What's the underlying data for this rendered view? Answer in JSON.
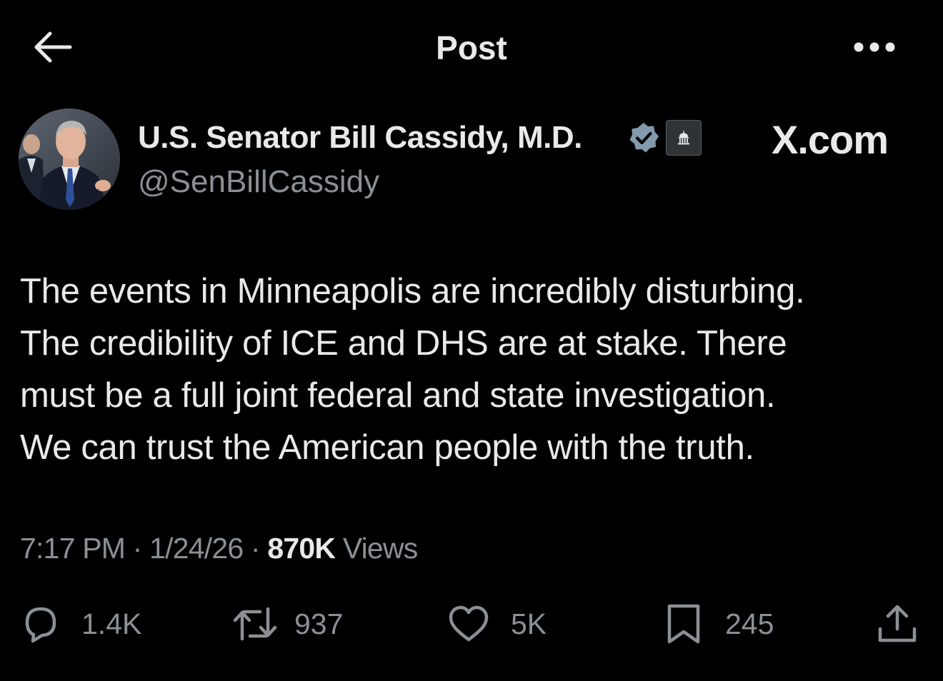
{
  "header": {
    "title": "Post",
    "back_icon": "arrow-left-icon",
    "more_icon": "more-horizontal-icon"
  },
  "author": {
    "display_name": "U.S. Senator Bill Cassidy, M.D.",
    "handle": "@SenBillCassidy",
    "verified_icon": "verified-badge-icon",
    "affiliation_icon": "government-building-icon"
  },
  "watermark": "X.com",
  "tweet": {
    "lines": [
      "The events in Minneapolis are incredibly disturbing.",
      "The credibility of ICE and DHS are at stake. There",
      "must be a full joint federal and state investigation.",
      "We can trust the American people with the truth."
    ]
  },
  "meta": {
    "time": "7:17 PM",
    "separator": " · ",
    "date": "1/24/26",
    "views_count": "870K",
    "views_label": "Views"
  },
  "actions": {
    "reply": {
      "icon": "reply-icon",
      "count": "1.4K"
    },
    "repost": {
      "icon": "repost-icon",
      "count": "937"
    },
    "like": {
      "icon": "heart-icon",
      "count": "5K"
    },
    "bookmark": {
      "icon": "bookmark-icon",
      "count": "245"
    },
    "share": {
      "icon": "share-icon"
    }
  },
  "colors": {
    "background": "#000000",
    "text": "#e7e9ea",
    "muted": "#8b9096",
    "verified_badge": "#829aab"
  }
}
